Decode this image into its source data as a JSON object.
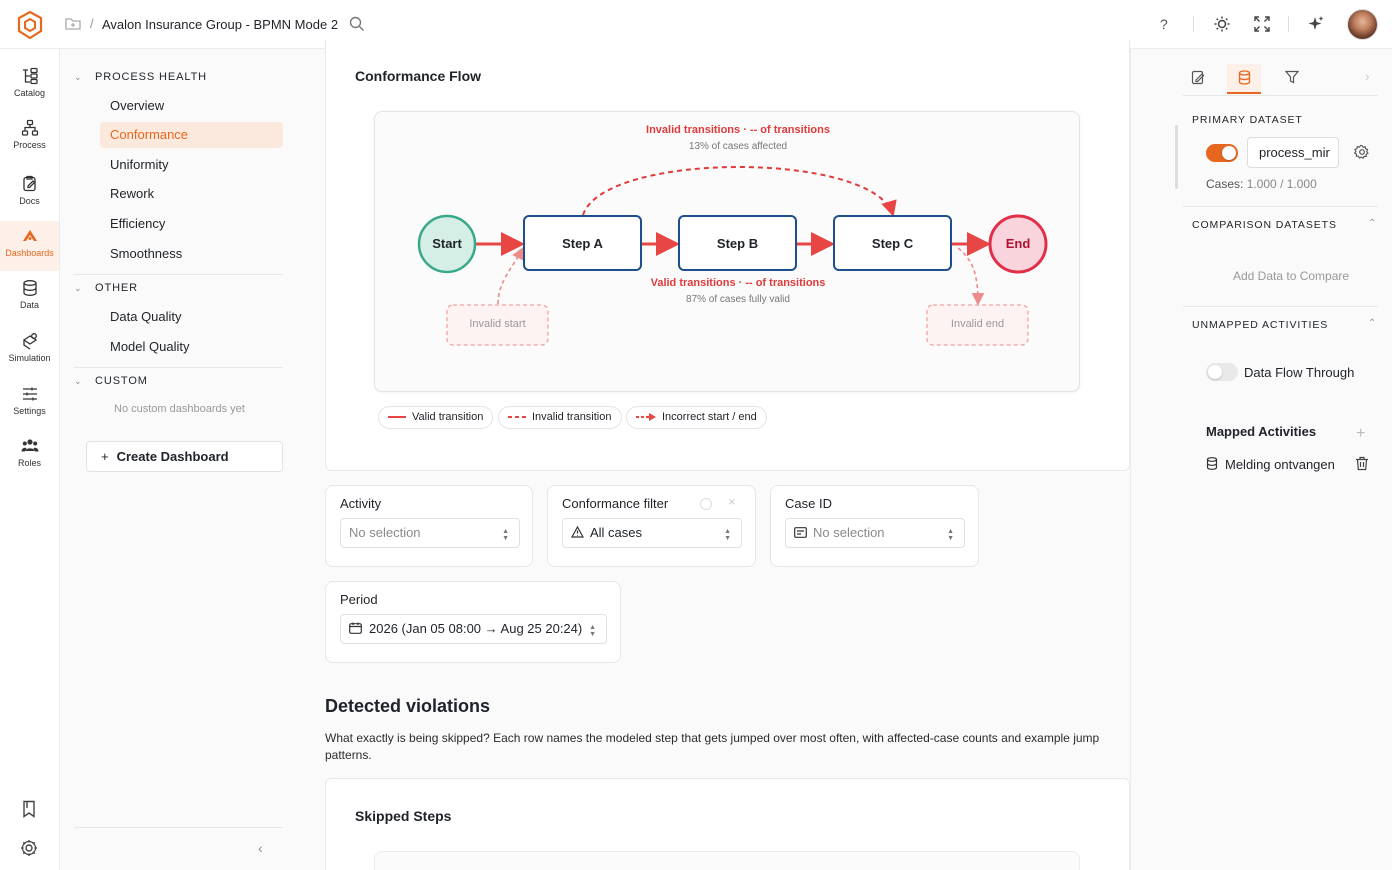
{
  "header": {
    "title": "Avalon Insurance Group - BPMN Mode 2",
    "separator": "/",
    "help": "?"
  },
  "rail": {
    "items": [
      {
        "label": "Catalog",
        "icon": "catalog-icon"
      },
      {
        "label": "Process",
        "icon": "process-icon"
      },
      {
        "label": "Docs",
        "icon": "docs-icon"
      },
      {
        "label": "Dashboards",
        "icon": "dashboards-icon"
      },
      {
        "label": "Data",
        "icon": "data-icon"
      },
      {
        "label": "Simulation",
        "icon": "simulation-icon"
      },
      {
        "label": "Settings",
        "icon": "settings-icon"
      },
      {
        "label": "Roles",
        "icon": "roles-icon"
      }
    ],
    "active": "Dashboards"
  },
  "nav": {
    "sections": [
      {
        "title": "PROCESS HEALTH",
        "items": [
          "Overview",
          "Conformance",
          "Uniformity",
          "Rework",
          "Efficiency",
          "Smoothness"
        ]
      },
      {
        "title": "OTHER",
        "items": [
          "Data Quality",
          "Model Quality"
        ]
      },
      {
        "title": "CUSTOM",
        "empty": "No custom dashboards yet"
      }
    ],
    "active_item": "Conformance",
    "create_button": "Create Dashboard",
    "create_plus": "+"
  },
  "flow_card": {
    "title": "Conformance Flow",
    "invalid_title": "Invalid transitions · -- of transitions",
    "invalid_sub": "13% of cases affected",
    "valid_title": "Valid transitions · -- of transitions",
    "valid_sub": "87% of cases fully valid",
    "nodes": {
      "start": "Start",
      "step_a": "Step A",
      "step_b": "Step B",
      "step_c": "Step C",
      "end": "End"
    },
    "invalid_start": "Invalid start",
    "invalid_end": "Invalid end",
    "legend": [
      "Valid transition",
      "Invalid transition",
      "Incorrect start / end"
    ],
    "colors": {
      "valid": "#e84545",
      "start": "#3aa88a",
      "end": "#e0304a",
      "step_border": "#1e4f8a"
    }
  },
  "filters": {
    "activity": {
      "label": "Activity",
      "value": "No selection"
    },
    "conformance": {
      "label": "Conformance filter",
      "value": "All cases"
    },
    "case_id": {
      "label": "Case ID",
      "value": "No selection"
    },
    "period": {
      "label": "Period",
      "value": "2026 (Jan 05 08:00 → Aug 25 20:24)"
    }
  },
  "violations": {
    "heading": "Detected violations",
    "description": "What exactly is being skipped? Each row names the modeled step that gets jumped over most often, with affected-case counts and example jump patterns.",
    "card_title": "Skipped Steps"
  },
  "right_panel": {
    "primary_title": "PRIMARY DATASET",
    "dataset_name": "process_mir",
    "dataset_toggle": true,
    "cases_label": "Cases:",
    "cases_value": "1.000 / 1.000",
    "comparison_title": "COMPARISON DATASETS",
    "add_compare": "Add Data to Compare",
    "unmapped_title": "UNMAPPED ACTIVITIES",
    "data_flow_label": "Data Flow Through",
    "data_flow_toggle": false,
    "mapped_title": "Mapped Activities",
    "mapped_items": [
      "Melding ontvangen"
    ]
  },
  "accent": "#e8671e"
}
